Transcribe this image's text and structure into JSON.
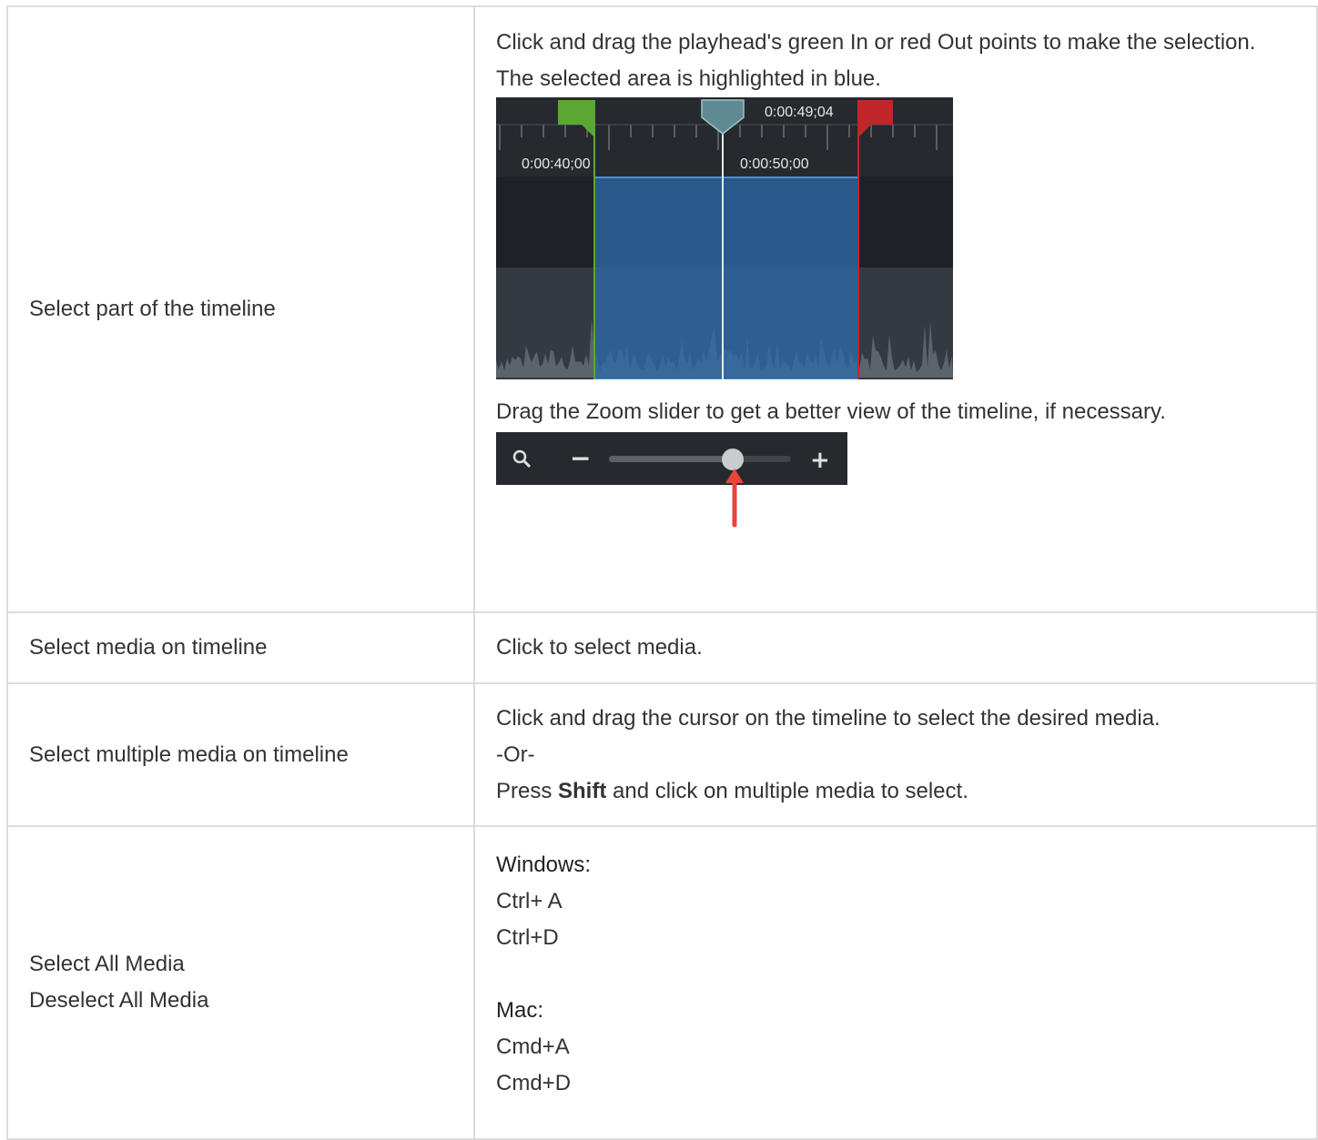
{
  "rows": [
    {
      "action": "Select part of the timeline",
      "desc_1": "Click and drag the playhead's green In or red Out points to make the selection.",
      "desc_2": "The selected area is highlighted in blue.",
      "timeline_image": {
        "playhead_time": "0:00:49;04",
        "tick_label_1": "0:00:40;00",
        "tick_label_2": "0:00:50;00",
        "selection_color": "#2e6aa8",
        "in_point_color": "#5aa832",
        "out_point_color": "#c0262a",
        "playhead_color": "#5f8a93"
      },
      "desc_3": "Drag the Zoom slider to get a better view of the timeline, if necessary.",
      "zoom_image": {
        "minus": "−",
        "plus": "+",
        "zoom_level": 0.68,
        "arrow_color": "#e8453c",
        "icon": "magnifier-icon"
      }
    },
    {
      "action": "Select media on timeline",
      "desc_1": "Click to select media."
    },
    {
      "action": "Select multiple media on timeline",
      "desc_1": "Click and drag the cursor on the timeline to select the desired media.",
      "desc_2": "-Or-",
      "desc_3_prefix": "Press ",
      "desc_3_key": "Shift",
      "desc_3_suffix": " and click on multiple media to select."
    },
    {
      "action_1": "Select All Media",
      "action_2": "Deselect All Media",
      "windows_label": "Windows:",
      "windows_1": "Ctrl+ A",
      "windows_2": "Ctrl+D",
      "mac_label": "Mac:",
      "mac_1": "Cmd+A",
      "mac_2": "Cmd+D"
    }
  ]
}
